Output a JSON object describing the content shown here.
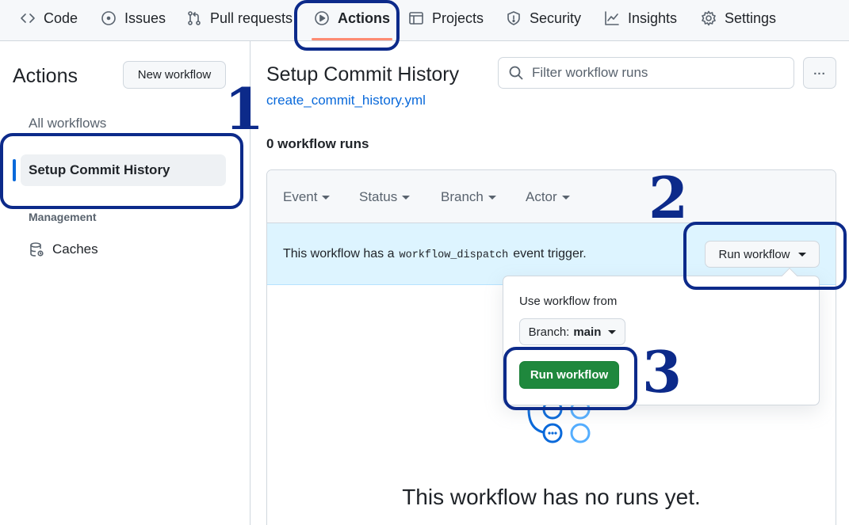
{
  "nav": {
    "items": [
      {
        "label": "Code",
        "icon": "code-icon"
      },
      {
        "label": "Issues",
        "icon": "issue-icon"
      },
      {
        "label": "Pull requests",
        "icon": "pull-request-icon"
      },
      {
        "label": "Actions",
        "icon": "play-icon",
        "active": true
      },
      {
        "label": "Projects",
        "icon": "table-icon"
      },
      {
        "label": "Security",
        "icon": "shield-icon"
      },
      {
        "label": "Insights",
        "icon": "graph-icon"
      },
      {
        "label": "Settings",
        "icon": "gear-icon"
      }
    ]
  },
  "sidebar": {
    "title": "Actions",
    "new_workflow_label": "New workflow",
    "all_workflows_label": "All workflows",
    "selected_workflow": "Setup Commit History",
    "section_label": "Management",
    "caches_label": "Caches"
  },
  "main": {
    "workflow_title": "Setup Commit History",
    "workflow_file": "create_commit_history.yml",
    "search_placeholder": "Filter workflow runs",
    "kebab_label": "...",
    "run_count": "0 workflow runs",
    "filters": [
      "Event",
      "Status",
      "Branch",
      "Actor"
    ],
    "dispatch_prefix": "This workflow has a",
    "dispatch_code": "workflow_dispatch",
    "dispatch_suffix": "event trigger.",
    "run_workflow_label": "Run workflow",
    "empty_title": "This workflow has no runs yet."
  },
  "popover": {
    "use_from_label": "Use workflow from",
    "branch_prefix": "Branch:",
    "branch_value": "main",
    "run_button_label": "Run workflow"
  },
  "annotations": {
    "step1": "1",
    "step2": "2",
    "step3": "3",
    "color": "#0c2a8a"
  },
  "colors": {
    "accent_blue": "#0969da",
    "green_button": "#1f883d",
    "nav_underline": "#fd8c73",
    "dispatch_bg": "#ddf4ff"
  }
}
